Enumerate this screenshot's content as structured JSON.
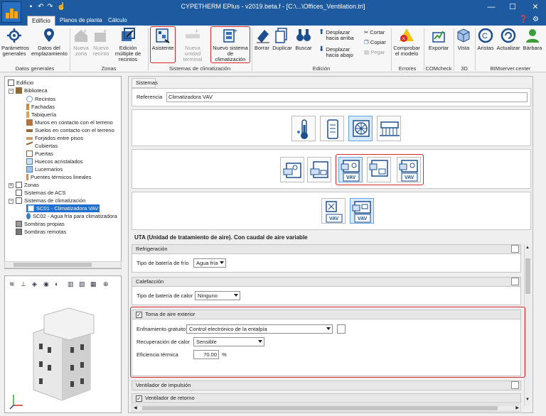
{
  "window": {
    "title": "CYPETHERM EPlus - v2019.beta.f - [C:\\...\\Offices_Ventilation.tri]",
    "min_label": "—",
    "max_label": "☐",
    "close_label": "✕"
  },
  "ribbon_tabs": [
    {
      "label": "Edificio",
      "active": true
    },
    {
      "label": "Planos de planta",
      "active": false
    },
    {
      "label": "Cálculo",
      "active": false
    }
  ],
  "ribbon": {
    "buttons": {
      "parametros": "Parámetros generales",
      "datos_emplazamiento": "Datos del emplazamiento",
      "nueva_zona": "Nueva zona",
      "nuevo_recinto": "Nuevo recinto",
      "edicion_multiple": "Edición múltiple de recintos",
      "asistente": "Asistente",
      "nueva_unidad_terminal": "Nueva unidad terminal",
      "nuevo_sistema": "Nuevo sistema de climatización",
      "borrar": "Borrar",
      "duplicar": "Duplicar",
      "buscar": "Buscar",
      "desplazar_arriba": "Desplazar hacia arriba",
      "desplazar_abajo": "Desplazar hacia abajo",
      "cortar": "Cortar",
      "copiar": "Copiar",
      "pegar": "Pegar",
      "comprobar": "Comprobar el modelo",
      "exportar": "Exportar",
      "vista": "Vista",
      "aristas": "Aristas",
      "actualizar": "Actualizar",
      "barbara": "Bárbara"
    },
    "groups": {
      "datos_generales": "Datos generales",
      "zonas": "Zonas",
      "sistemas": "Sistemas de climatización",
      "edicion": "Edición",
      "errores": "Errores",
      "comcheck": "COMcheck",
      "tres_d": "3D",
      "bimserver": "BIMserver.center"
    }
  },
  "tree": {
    "items": [
      {
        "label": "Edificio"
      },
      {
        "label": "Biblioteca"
      },
      {
        "label": "Recintos"
      },
      {
        "label": "Fachadas"
      },
      {
        "label": "Tabiquería"
      },
      {
        "label": "Muros en contacto con el terreno"
      },
      {
        "label": "Suelos en contacto con el terreno"
      },
      {
        "label": "Forjados entre pisos"
      },
      {
        "label": "Cubiertas"
      },
      {
        "label": "Puertas"
      },
      {
        "label": "Huecos acristalados"
      },
      {
        "label": "Lucernarios"
      },
      {
        "label": "Puentes térmicos lineales"
      },
      {
        "label": "Zonas"
      },
      {
        "label": "Sistemas de ACS"
      },
      {
        "label": "Sistemas de climatización"
      },
      {
        "label": "SC01 - Climatizadora VAV"
      },
      {
        "label": "SC02 - Agua fría para climatizadora"
      },
      {
        "label": "Sombras propias"
      },
      {
        "label": "Sombras remotas"
      }
    ]
  },
  "main": {
    "header": "Sistemas",
    "referencia_label": "Referencia",
    "referencia_value": "Climatizadora VAV",
    "vav_label": "VAV",
    "system_title": "UTA (Unidad de tratamiento de aire). Con caudal de aire variable",
    "refrigeracion": {
      "header": "Refrigeración",
      "label": "Tipo de batería de frío",
      "value": "Agua fría"
    },
    "calefaccion": {
      "header": "Calefacción",
      "label": "Tipo de batería de calor",
      "value": "Ninguno"
    },
    "toma": {
      "header": "Toma de aire exterior",
      "checked": true,
      "enfriamiento_label": "Enfriamiento gratuito",
      "enfriamiento_value": "Control electrónico de la entalpía",
      "recuperacion_label": "Recuperación de calor",
      "recuperacion_value": "Sensible",
      "eficiencia_label": "Eficiencia térmica",
      "eficiencia_value": "70.00",
      "eficiencia_unit": "%"
    },
    "ventilador_impulsion": "Ventilador de impulsión",
    "ventilador_retorno": "Ventilador de retorno"
  },
  "colors": {
    "titlebar": "#1e5aa0",
    "highlight": "#d9282a",
    "selected": "#1e6fd0"
  }
}
